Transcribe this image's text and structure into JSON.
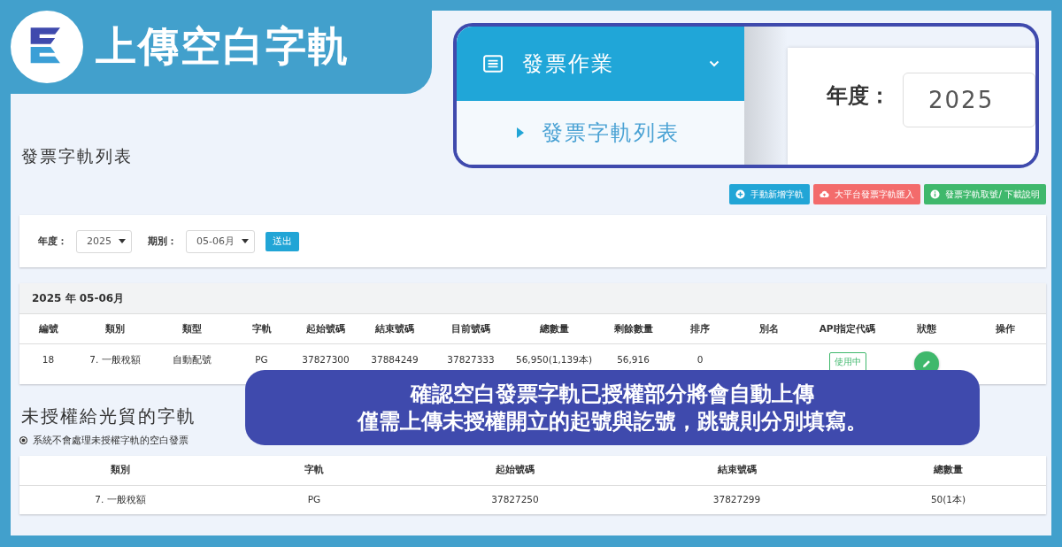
{
  "title": "上傳空白字軌",
  "page_heading": "發票字軌列表",
  "actions": [
    {
      "kind": "add",
      "label": "手動新增字軌",
      "color": "#21a5d6"
    },
    {
      "kind": "upload",
      "label": "大平台發票字軌匯入",
      "color": "#f36b6b"
    },
    {
      "kind": "info",
      "label": "發票字軌取號/ 下載說明",
      "color": "#3fb86c"
    }
  ],
  "filter": {
    "year_label": "年度：",
    "year": "2025",
    "period_label": "期別：",
    "period": "05-06月",
    "submit": "送出"
  },
  "track_table": {
    "caption": "2025 年 05-06月",
    "columns": [
      "編號",
      "類別",
      "類型",
      "字軌",
      "起始號碼",
      "結束號碼",
      "目前號碼",
      "總數量",
      "剩餘數量",
      "排序",
      "別名",
      "API指定代碼",
      "狀態",
      "操作"
    ],
    "rows": [
      {
        "cells": [
          "18",
          "7. 一般稅額",
          "自動配號",
          "PG",
          "37827300",
          "37884249",
          "37827333",
          "56,950(1,139本)",
          "56,916",
          "0",
          ""
        ],
        "status": "使用中"
      }
    ]
  },
  "unauthorized": {
    "heading": "未授權給光貿的字軌",
    "option": {
      "label": "系統不會處理未授權字軌的空白發票",
      "selected": true
    },
    "columns": [
      "類別",
      "字軌",
      "起始號碼",
      "結束號碼",
      "總數量"
    ],
    "rows": [
      [
        "7. 一般稅額",
        "PG",
        "37827250",
        "37827299",
        "50(1本)"
      ]
    ]
  },
  "zoom_callout": {
    "menu": "發票作業",
    "submenu": "發票字軌列表",
    "year_label": "年度：",
    "year": "2025"
  },
  "banner": {
    "lines": [
      "確認空白發票字軌已授權部分將會自動上傳",
      "僅需上傳未授權開立的起號與訖號，跳號則分別填寫。"
    ]
  }
}
